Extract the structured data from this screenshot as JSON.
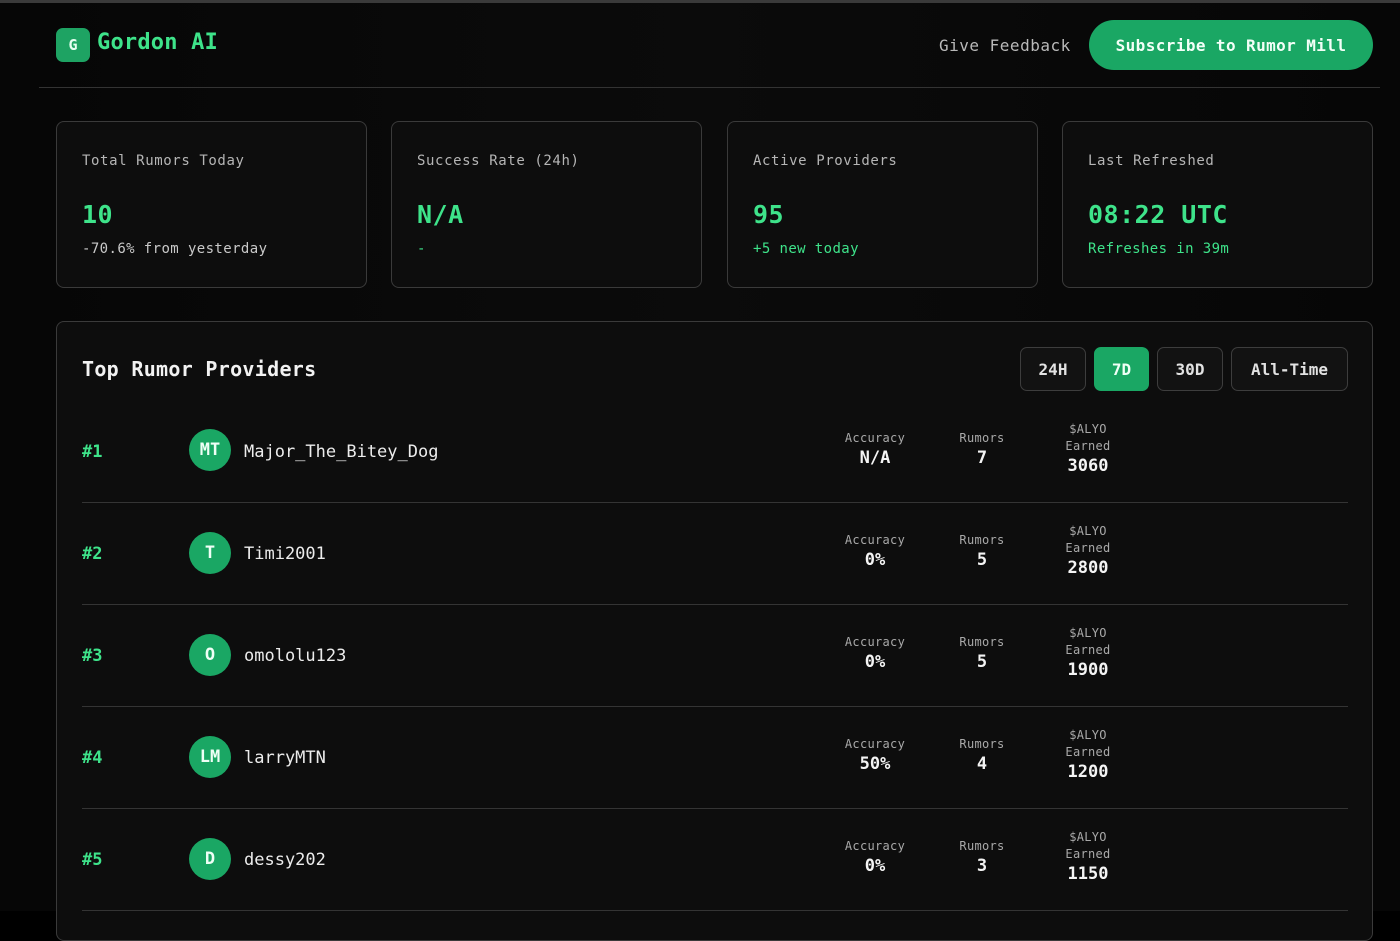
{
  "header": {
    "logo_letter": "G",
    "brand": "Gordon AI",
    "feedback_label": "Give Feedback",
    "subscribe_label": "Subscribe to Rumor Mill"
  },
  "stats": [
    {
      "label": "Total Rumors Today",
      "value": "10",
      "sub": "-70.6% from yesterday"
    },
    {
      "label": "Success Rate (24h)",
      "value": "N/A",
      "sub": "-"
    },
    {
      "label": "Active Providers",
      "value": "95",
      "sub": "+5 new today"
    },
    {
      "label": "Last Refreshed",
      "value": "08:22 UTC",
      "sub": "Refreshes in 39m"
    }
  ],
  "leaderboard": {
    "title": "Top Rumor Providers",
    "filters": [
      {
        "label": "24H",
        "active": false
      },
      {
        "label": "7D",
        "active": true
      },
      {
        "label": "30D",
        "active": false
      },
      {
        "label": "All-Time",
        "active": false
      }
    ],
    "metric_labels": {
      "accuracy": "Accuracy",
      "rumors": "Rumors",
      "earned_line1": "$ALYO",
      "earned_line2": "Earned"
    },
    "rows": [
      {
        "rank": "#1",
        "initials": "MT",
        "name": "Major_The_Bitey_Dog",
        "accuracy": "N/A",
        "rumors": "7",
        "earned": "3060"
      },
      {
        "rank": "#2",
        "initials": "T",
        "name": "Timi2001",
        "accuracy": "0%",
        "rumors": "5",
        "earned": "2800"
      },
      {
        "rank": "#3",
        "initials": "O",
        "name": "omololu123",
        "accuracy": "0%",
        "rumors": "5",
        "earned": "1900"
      },
      {
        "rank": "#4",
        "initials": "LM",
        "name": "larryMTN",
        "accuracy": "50%",
        "rumors": "4",
        "earned": "1200"
      },
      {
        "rank": "#5",
        "initials": "D",
        "name": "dessy202",
        "accuracy": "0%",
        "rumors": "3",
        "earned": "1150"
      }
    ]
  },
  "colors": {
    "accent": "#1aa764",
    "accent_text": "#3ee38a",
    "background": "#000000",
    "card": "#0d0d0d",
    "border": "#3a3a3a"
  }
}
